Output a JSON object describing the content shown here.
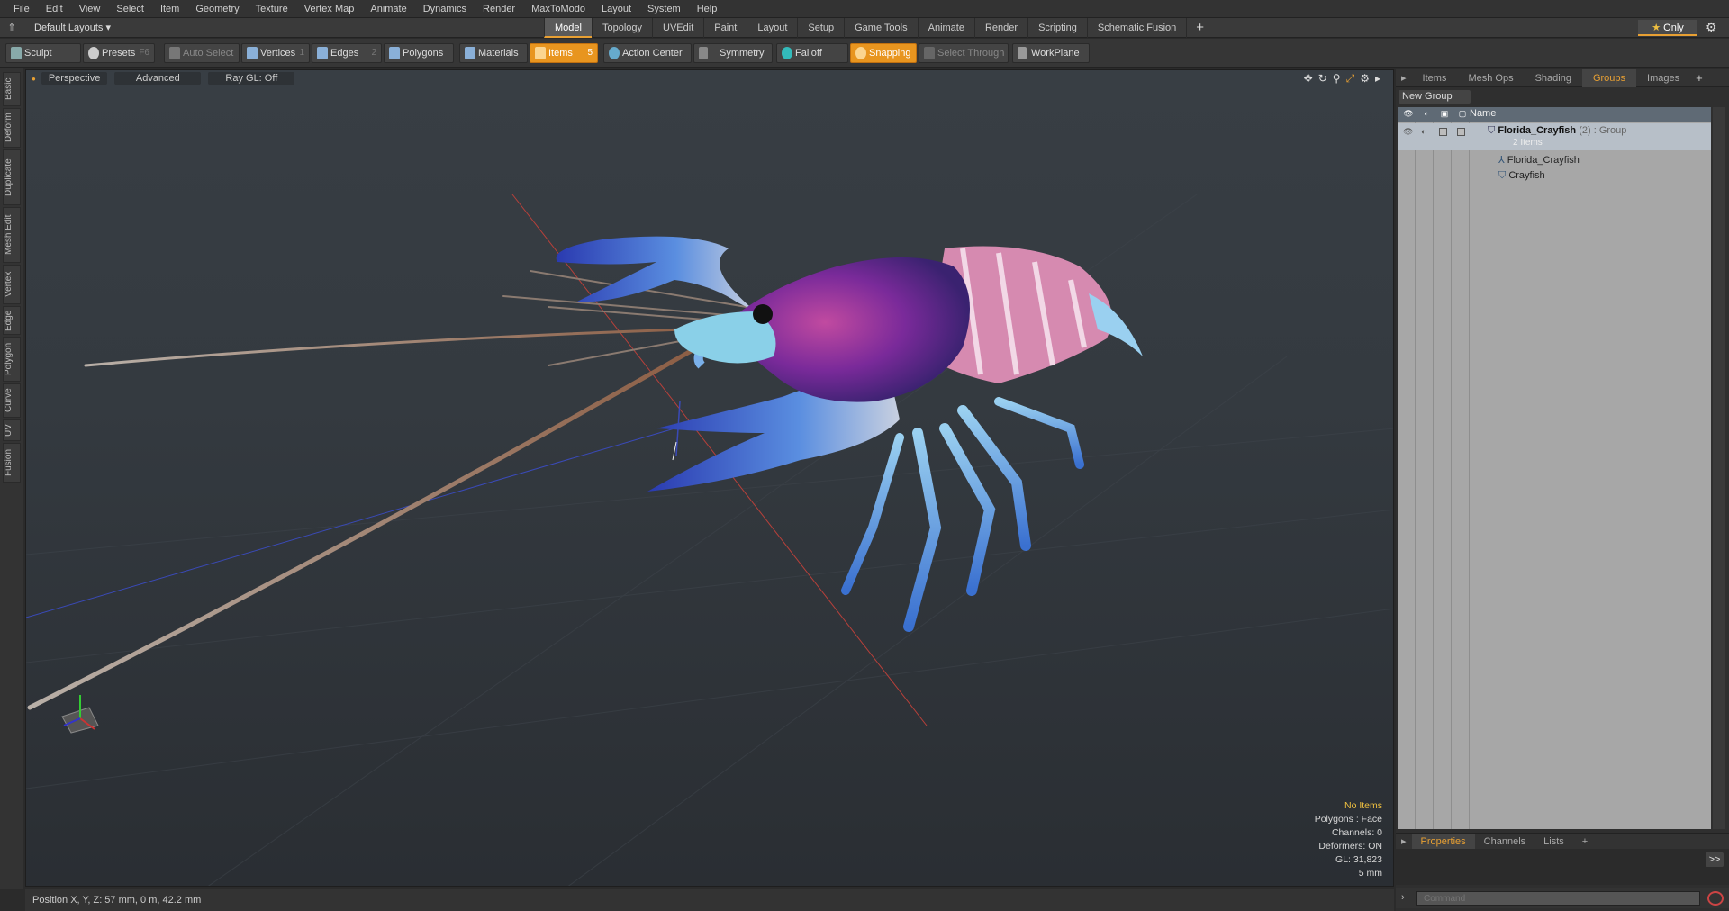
{
  "menu": [
    "File",
    "Edit",
    "View",
    "Select",
    "Item",
    "Geometry",
    "Texture",
    "Vertex Map",
    "Animate",
    "Dynamics",
    "Render",
    "MaxToModo",
    "Layout",
    "System",
    "Help"
  ],
  "layout": {
    "selector": "Default Layouts ▾",
    "tabs": [
      "Model",
      "Topology",
      "UVEdit",
      "Paint",
      "Layout",
      "Setup",
      "Game Tools",
      "Animate",
      "Render",
      "Scripting",
      "Schematic Fusion"
    ],
    "active_tab": "Model",
    "only_label": "Only"
  },
  "toolbar": {
    "sculpt": "Sculpt",
    "presets": "Presets",
    "presets_key": "F6",
    "auto_select": "Auto Select",
    "vertices": "Vertices",
    "vertices_key": "1",
    "edges": "Edges",
    "edges_key": "2",
    "polygons": "Polygons",
    "materials": "Materials",
    "items": "Items",
    "items_key": "5",
    "action_center": "Action Center",
    "symmetry": "Symmetry",
    "falloff": "Falloff",
    "snapping": "Snapping",
    "select_through": "Select Through",
    "workplane": "WorkPlane"
  },
  "left_tabs": [
    "Basic",
    "Deform",
    "Duplicate",
    "Mesh Edit",
    "Vertex",
    "Edge",
    "Polygon",
    "Curve",
    "UV",
    "Fusion"
  ],
  "viewport": {
    "view": "Perspective",
    "shading": "Advanced",
    "raygl": "Ray GL: Off",
    "stats": {
      "selection": "No Items",
      "polygons": "Polygons : Face",
      "channels": "Channels: 0",
      "deformers": "Deformers: ON",
      "gl": "GL: 31,823",
      "scale": "5 mm"
    }
  },
  "status": {
    "position": "Position X, Y, Z:   57 mm, 0 m, 42.2 mm"
  },
  "right_panel": {
    "tabs": [
      "Items",
      "Mesh Ops",
      "Shading",
      "Groups",
      "Images"
    ],
    "active_tab": "Groups",
    "new_group": "New Group",
    "name_col": "Name",
    "group": {
      "name": "Florida_Crayfish",
      "count": "(2)",
      "type": ": Group",
      "sub": "2 Items"
    },
    "children": [
      "Florida_Crayfish",
      "Crayfish"
    ]
  },
  "bottom_panel": {
    "tabs": [
      "Properties",
      "Channels",
      "Lists"
    ],
    "active_tab": "Properties",
    "command_placeholder": "Command",
    "arrow": ">>"
  }
}
